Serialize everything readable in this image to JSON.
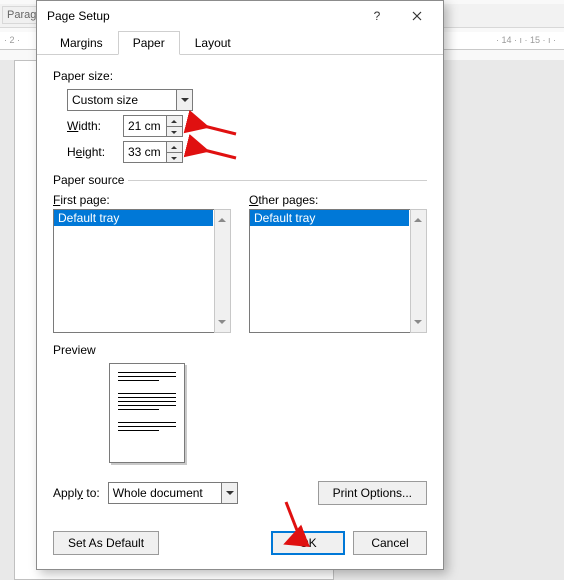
{
  "background": {
    "ribbon_group": "Paragra",
    "ruler_left": "· 2 ·",
    "ruler_right": "· 14 · ı · 15 · ı ·"
  },
  "dialog": {
    "title": "Page Setup",
    "tabs": {
      "margins": "Margins",
      "paper": "Paper",
      "layout": "Layout"
    },
    "paper_size_label": "Paper size:",
    "paper_size_value": "Custom size",
    "width_label": "Width:",
    "width_value": "21 cm",
    "height_label": "Height:",
    "height_value": "33 cm",
    "paper_source_label": "Paper source",
    "first_page_label": "First page:",
    "other_pages_label": "Other pages:",
    "first_page_items": [
      "Default tray"
    ],
    "other_pages_items": [
      "Default tray"
    ],
    "preview_label": "Preview",
    "apply_to_label": "Apply to:",
    "apply_to_value": "Whole document",
    "print_options": "Print Options...",
    "set_as_default": "Set As Default",
    "ok": "OK",
    "cancel": "Cancel"
  }
}
